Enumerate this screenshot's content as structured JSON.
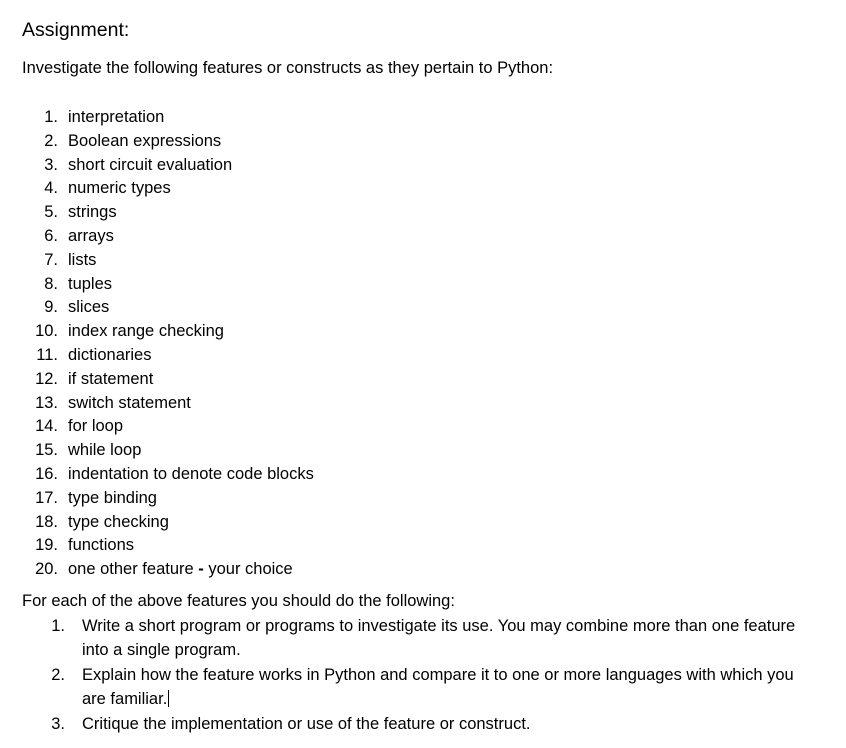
{
  "document": {
    "title": "Assignment:",
    "intro": "Investigate the following features or constructs as they pertain to Python:",
    "features": [
      {
        "number": "1.",
        "label": "interpretation"
      },
      {
        "number": "2.",
        "label": "Boolean expressions"
      },
      {
        "number": "3.",
        "label": "short circuit evaluation"
      },
      {
        "number": "4.",
        "label": "numeric types"
      },
      {
        "number": "5.",
        "label": "strings"
      },
      {
        "number": "6.",
        "label": "arrays"
      },
      {
        "number": "7.",
        "label": "lists"
      },
      {
        "number": "8.",
        "label": "tuples"
      },
      {
        "number": "9.",
        "label": "slices"
      },
      {
        "number": "10.",
        "label": "index range checking"
      },
      {
        "number": "11.",
        "label": "dictionaries"
      },
      {
        "number": "12.",
        "label": "if statement"
      },
      {
        "number": "13.",
        "label": "switch statement"
      },
      {
        "number": "14.",
        "label": "for loop"
      },
      {
        "number": "15.",
        "label": "while loop"
      },
      {
        "number": "16.",
        "label": "indentation to denote code blocks"
      },
      {
        "number": "17.",
        "label": "type binding"
      },
      {
        "number": "18.",
        "label": "type checking"
      },
      {
        "number": "19.",
        "label": "functions"
      },
      {
        "number": "20.",
        "label_before_dash": "one other feature ",
        "dash": "-",
        "label_after_dash": " your choice"
      }
    ],
    "second_intro": "For each of the above features you should do the following:",
    "tasks": [
      {
        "number": "1.",
        "text": "Write a short program or programs to investigate its use. You may combine more than one feature into a single program."
      },
      {
        "number": "2.",
        "text": "Explain how the feature works in Python and compare it to one or more languages with which you are familiar."
      },
      {
        "number": "3.",
        "text": "Critique the implementation or use of the feature or construct."
      }
    ]
  },
  "editor": {
    "caret_visible": true,
    "caret_color": "#000000"
  },
  "colors": {
    "background": "#ffffff",
    "text": "#000000"
  }
}
